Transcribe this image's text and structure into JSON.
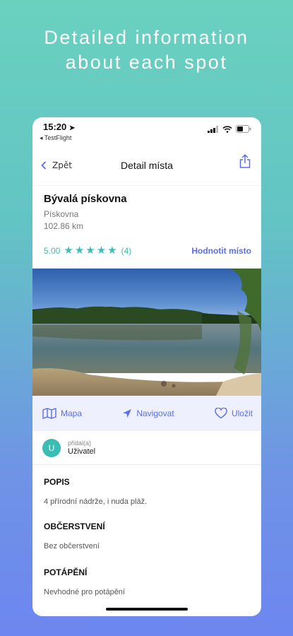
{
  "promo": {
    "line1": "Detailed information",
    "line2": "about each spot"
  },
  "status": {
    "time": "15:20",
    "back_app": "◂ TestFlight"
  },
  "nav": {
    "back_label": "Zpět",
    "title": "Detail místa",
    "share_icon": "share-icon"
  },
  "spot": {
    "name": "Bývalá pískovna",
    "type": "Pískovna",
    "distance": "102.86 km",
    "rating": "5.00",
    "stars": 5,
    "rating_count": "(4)",
    "rate_link": "Hodnotit místo"
  },
  "actions": {
    "map": "Mapa",
    "navigate": "Navigovat",
    "save": "Uložit"
  },
  "user": {
    "initial": "U",
    "added_by": "přidal(a)",
    "name": "Uživatel"
  },
  "sections": [
    {
      "title": "POPIS",
      "text": "4 přírodní nádrže, i nuda pláž."
    },
    {
      "title": "OBČERSTVENÍ",
      "text": "Bez občerstvení"
    },
    {
      "title": "POTÁPĚNÍ",
      "text": "Nevhodné pro potápění"
    }
  ],
  "colors": {
    "accent": "#5b6ee8",
    "teal": "#3bbdb4",
    "action_bg": "#eef0fd"
  }
}
